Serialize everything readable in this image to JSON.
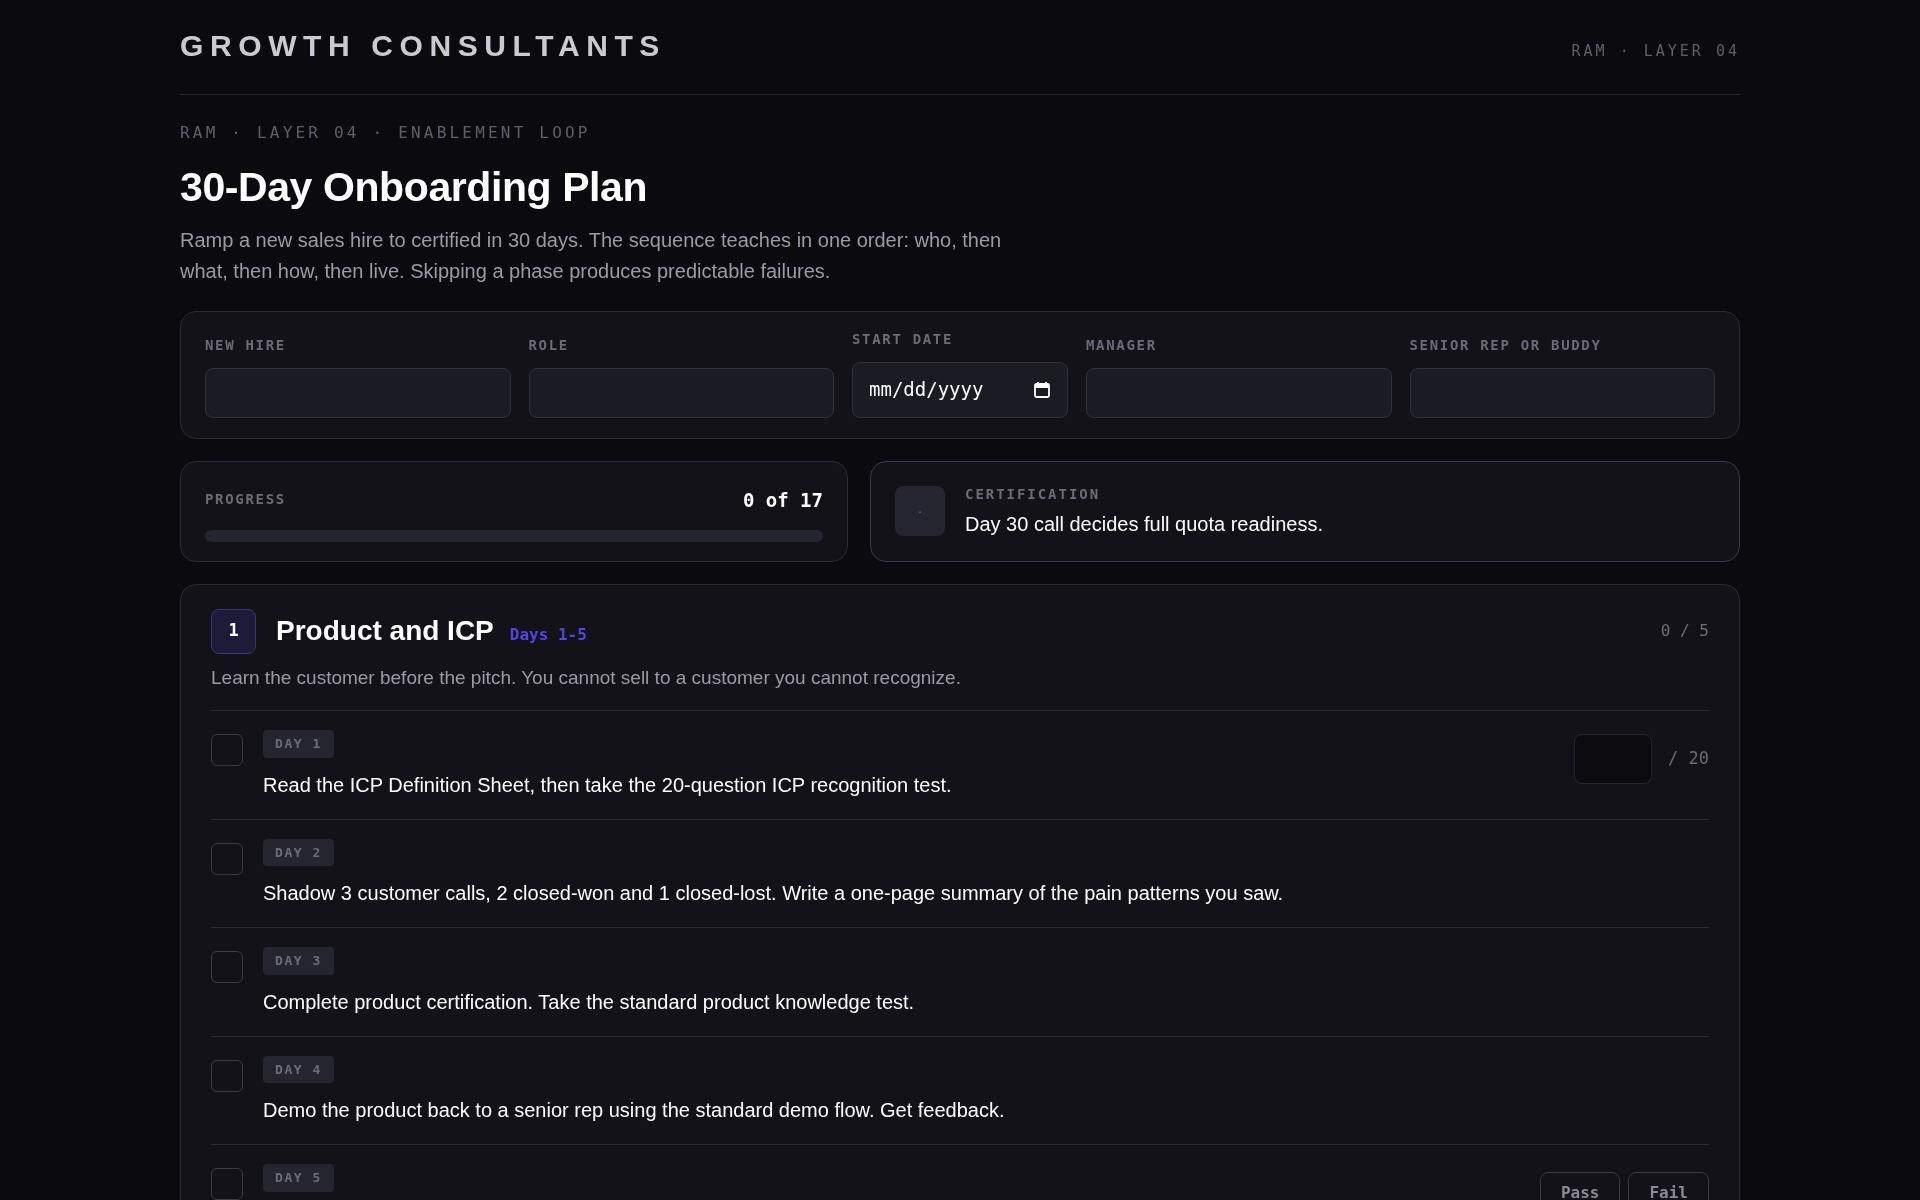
{
  "header": {
    "logo": "GROWTH CONSULTANTS",
    "tag": "RAM · LAYER 04"
  },
  "kicker": "RAM · LAYER 04 · ENABLEMENT LOOP",
  "title": "30-Day Onboarding Plan",
  "description": "Ramp a new sales hire to certified in 30 days. The sequence teaches in one order: who, then what, then how, then live. Skipping a phase produces predictable failures.",
  "fields": [
    {
      "label": "NEW HIRE",
      "kind": "text"
    },
    {
      "label": "ROLE",
      "kind": "text"
    },
    {
      "label": "START DATE",
      "kind": "date",
      "placeholder": "mm/dd/yyyy"
    },
    {
      "label": "MANAGER",
      "kind": "text"
    },
    {
      "label": "SENIOR REP OR BUDDY",
      "kind": "text"
    }
  ],
  "progress": {
    "label": "PROGRESS",
    "count": "0 of 17",
    "level": 0
  },
  "certification": {
    "badge": "·",
    "label": "CERTIFICATION",
    "text": "Day 30 call decides full quota readiness."
  },
  "phase": {
    "number": "1",
    "title": "Product and ICP",
    "days": "Days 1-5",
    "count": "0 / 5",
    "description": "Learn the customer before the pitch. You cannot sell to a customer you cannot recognize.",
    "tasks": [
      {
        "day": "DAY 1",
        "text": "Read the ICP Definition Sheet, then take the 20-question ICP recognition test.",
        "checked": false,
        "kind": "score",
        "suffix": "/ 20"
      },
      {
        "day": "DAY 2",
        "text": "Shadow 3 customer calls, 2 closed-won and 1 closed-lost. Write a one-page summary of the pain patterns you saw.",
        "checked": false,
        "kind": "plain"
      },
      {
        "day": "DAY 3",
        "text": "Complete product certification. Take the standard product knowledge test.",
        "checked": false,
        "kind": "plain"
      },
      {
        "day": "DAY 4",
        "text": "Demo the product back to a senior rep using the standard demo flow. Get feedback.",
        "checked": false,
        "kind": "plain"
      },
      {
        "day": "DAY 5",
        "checked": false,
        "kind": "passfail",
        "buttons": [
          "Pass",
          "Fail"
        ]
      }
    ]
  }
}
